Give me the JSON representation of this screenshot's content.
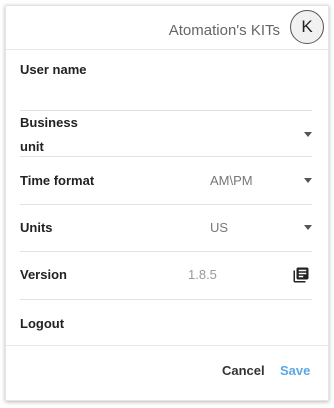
{
  "header": {
    "kit_name": "Atomation's KITs",
    "avatar_initial": "K"
  },
  "fields": {
    "user_name": {
      "label": "User name"
    },
    "business_unit": {
      "label_line1": "Business",
      "label_line2": "unit"
    },
    "time_format": {
      "label": "Time format",
      "value": "AM\\PM"
    },
    "units": {
      "label": "Units",
      "value": "US"
    },
    "version": {
      "label": "Version",
      "value": "1.8.5",
      "icon": "library-books-icon"
    },
    "logout": {
      "label": "Logout"
    }
  },
  "actions": {
    "cancel_label": "Cancel",
    "save_label": "Save"
  },
  "colors": {
    "save_accent": "#5aa9e6",
    "label_text": "#222222",
    "value_text": "#777777",
    "divider": "#e2e2e2"
  }
}
